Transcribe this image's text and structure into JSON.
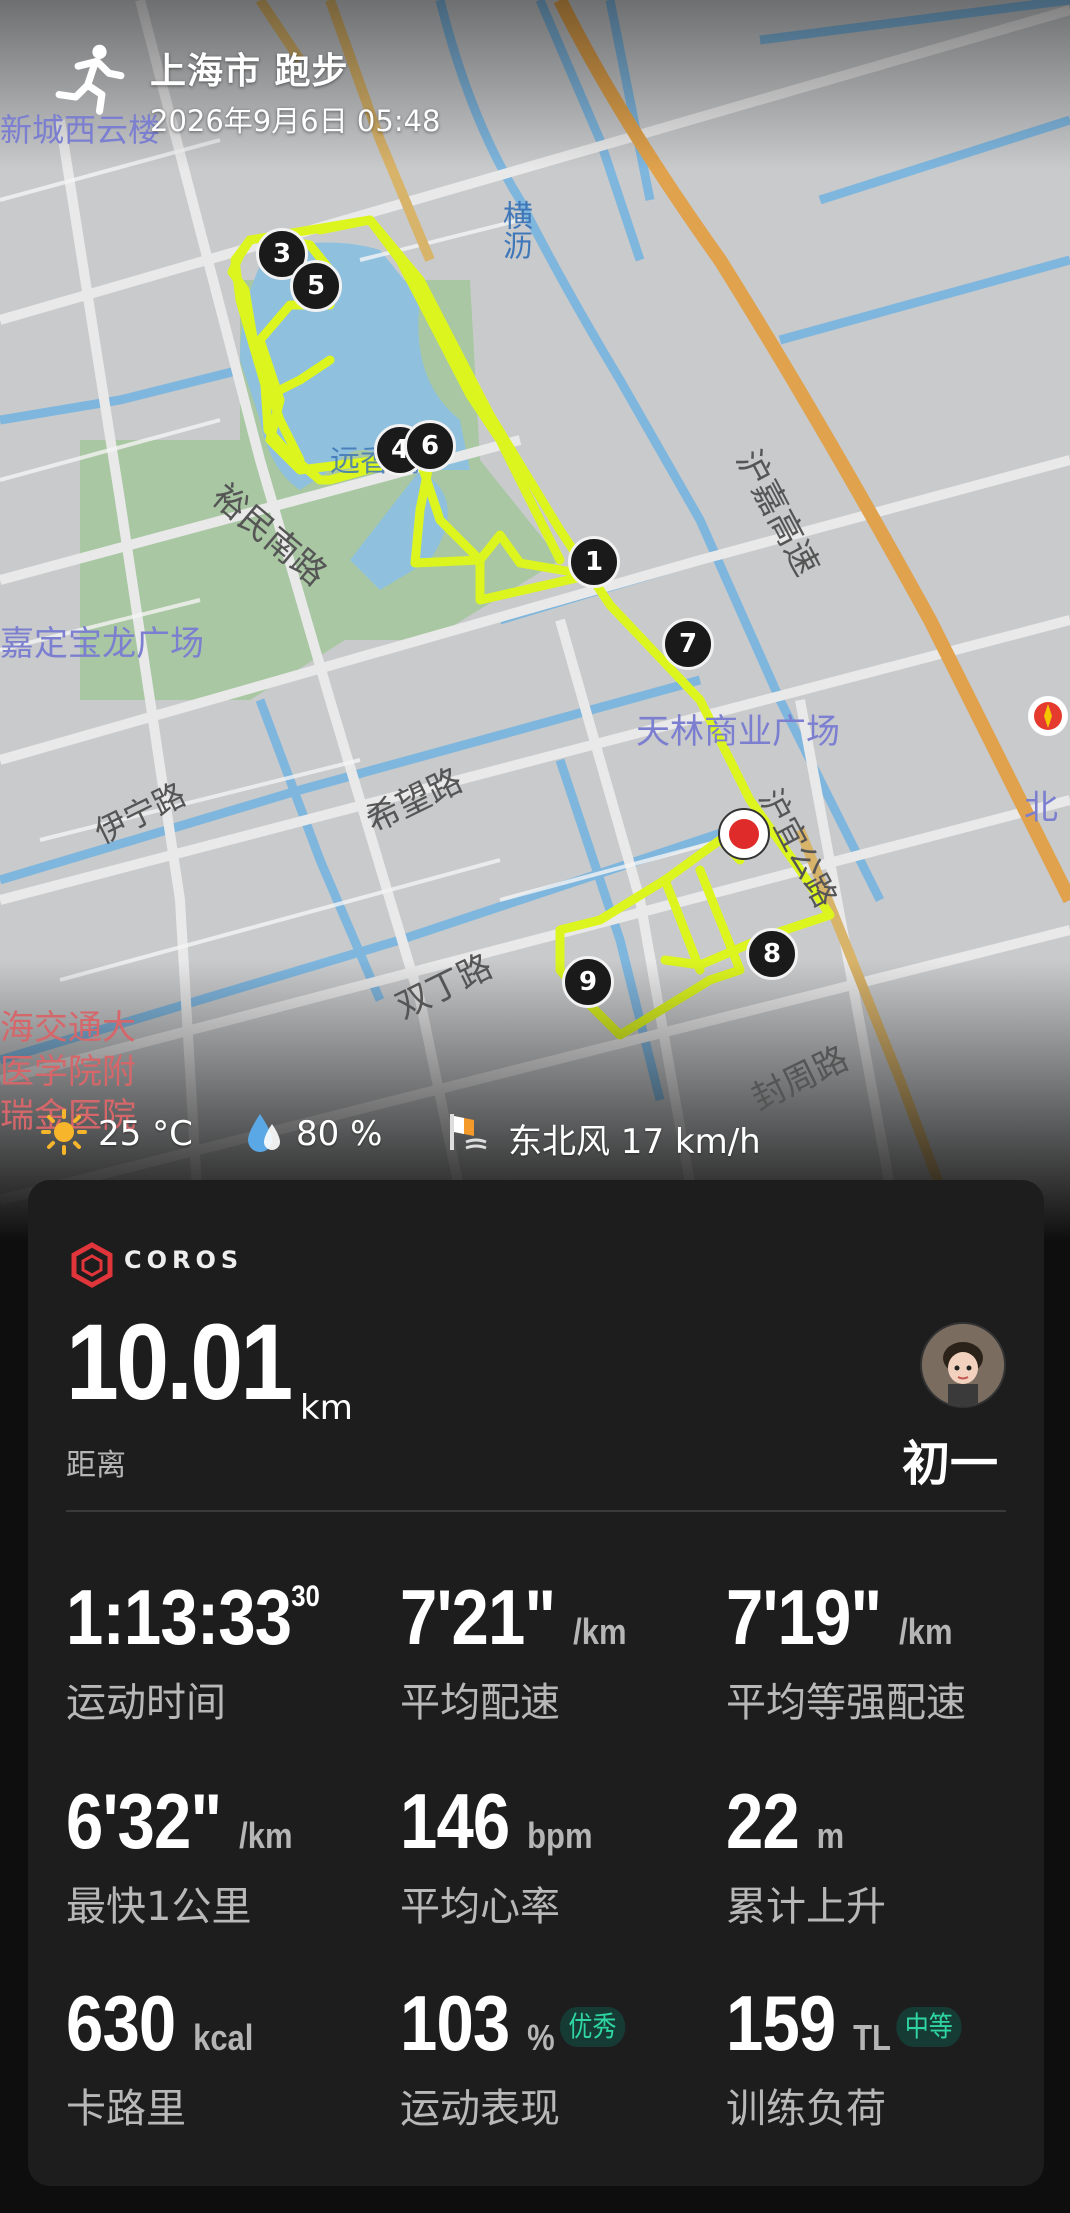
{
  "header": {
    "title": "上海市 跑步",
    "datetime": "2026年9月6日 05:48"
  },
  "map": {
    "labels": {
      "xincheng": "新城西云楼",
      "hengli": "横沥",
      "hujia": "沪嘉高速",
      "yunmin": "裕民南路",
      "baolong": "嘉定宝龙广场",
      "tianlin": "天林商业广场",
      "yining": "伊宁路",
      "xiwang": "希望路",
      "shuangding": "双丁路",
      "fengzhou": "封周路",
      "huyi": "沪宜公路",
      "hospital_1": "海交通大",
      "hospital_2": "医学院附",
      "hospital_3": "瑞金医院",
      "lake": "远香湖",
      "bei": "北"
    },
    "markers": [
      "1",
      "3",
      "4",
      "5",
      "6",
      "7",
      "8",
      "9"
    ]
  },
  "weather": {
    "temperature": "25 °C",
    "humidity": "80 %",
    "wind": "东北风 17 km/h"
  },
  "card": {
    "brand": "COROS",
    "distance": {
      "value": "10.01",
      "unit": "km",
      "label": "距离"
    },
    "user": {
      "name": "初一"
    },
    "metrics": {
      "time": {
        "value": "1:13:33",
        "sup": "30",
        "label": "运动时间"
      },
      "avg_pace": {
        "value": "7'21\"",
        "unit": "/km",
        "label": "平均配速"
      },
      "grade_pace": {
        "value": "7'19\"",
        "unit": "/km",
        "label": "平均等强配速"
      },
      "fastest_km": {
        "value": "6'32\"",
        "unit": "/km",
        "label": "最快1公里"
      },
      "heart_rate": {
        "value": "146",
        "unit": "bpm",
        "label": "平均心率"
      },
      "ascent": {
        "value": "22",
        "unit": "m",
        "label": "累计上升"
      },
      "calories": {
        "value": "630",
        "unit": "kcal",
        "label": "卡路里"
      },
      "performance": {
        "value": "103",
        "unit": "%",
        "badge": "优秀",
        "label": "运动表现"
      },
      "training_load": {
        "value": "159",
        "unit": "TL",
        "badge": "中等",
        "label": "训练负荷"
      }
    }
  },
  "colors": {
    "route": "#dcf51f",
    "badge_text": "#2fd6a4",
    "end_marker": "#e02b2b",
    "card_bg": "#1d1d1d"
  }
}
